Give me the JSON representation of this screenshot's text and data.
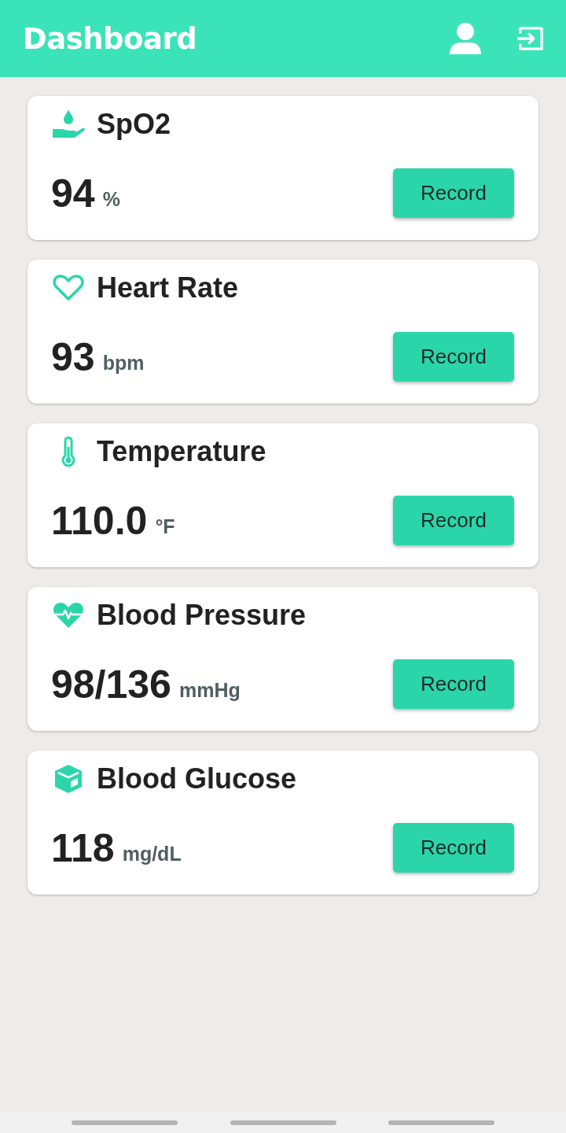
{
  "header": {
    "title": "Dashboard"
  },
  "cards": [
    {
      "kind": "hand-drop",
      "title": "SpO2",
      "value": "94",
      "unit": "%",
      "button": "Record"
    },
    {
      "kind": "heart",
      "title": "Heart Rate",
      "value": "93",
      "unit": "bpm",
      "button": "Record"
    },
    {
      "kind": "thermometer",
      "title": "Temperature",
      "value": "110.0",
      "unit": "°F",
      "button": "Record"
    },
    {
      "kind": "heart-pulse",
      "title": "Blood Pressure",
      "value": "98/136",
      "unit": "mmHg",
      "button": "Record"
    },
    {
      "kind": "cube",
      "title": "Blood Glucose",
      "value": "118",
      "unit": "mg/dL",
      "button": "Record"
    }
  ]
}
